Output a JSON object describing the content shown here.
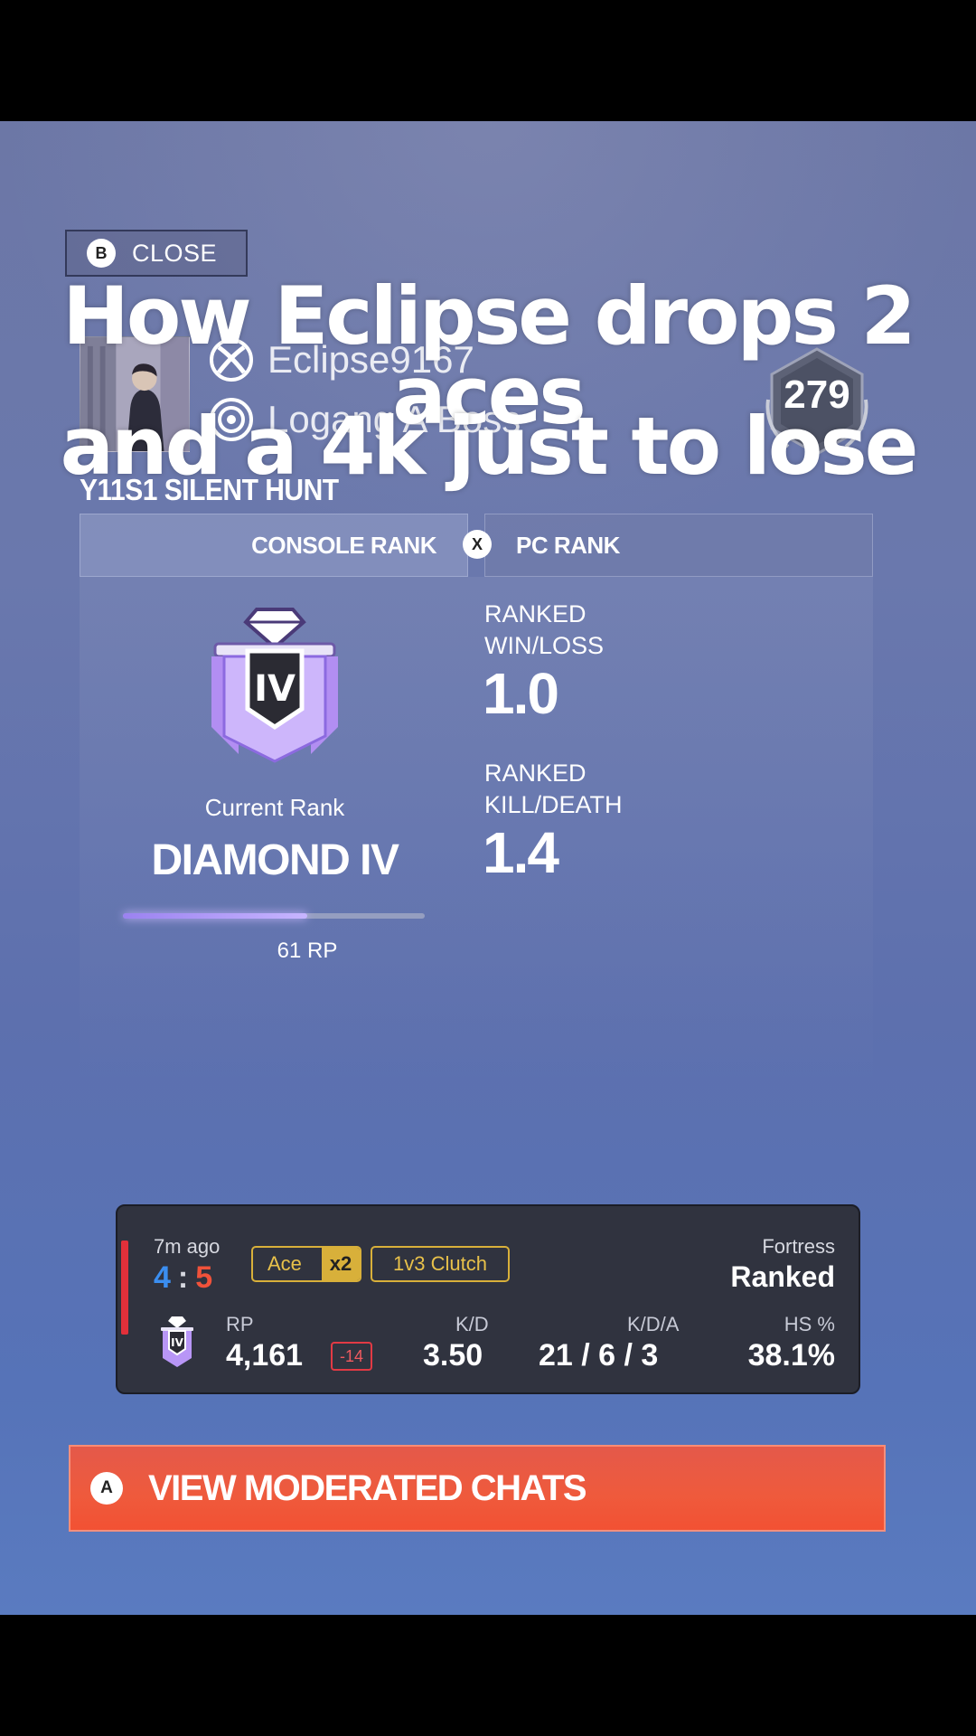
{
  "close_button": {
    "key": "B",
    "label": "CLOSE"
  },
  "profile": {
    "platforms": [
      {
        "icon": "xbox-icon",
        "name": "Eclipse9167"
      },
      {
        "icon": "ubisoft-icon",
        "name": "Logang A Boss"
      }
    ],
    "level": "279",
    "season": "Y11S1 SILENT HUNT"
  },
  "tabs": {
    "console": "CONSOLE RANK",
    "switch_key": "X",
    "pc": "PC RANK"
  },
  "rank": {
    "emblem_numeral": "IV",
    "current_label": "Current Rank",
    "name": "DIAMOND IV",
    "progress_fraction": 0.61,
    "rp_text": "61 RP",
    "stats": [
      {
        "label_line1": "RANKED",
        "label_line2": "WIN/LOSS",
        "value": "1.0"
      },
      {
        "label_line1": "RANKED",
        "label_line2": "KILL/DEATH",
        "value": "1.4"
      }
    ]
  },
  "match": {
    "time_ago": "7m ago",
    "score_blue": "4",
    "score_sep": ":",
    "score_red": "5",
    "badges": {
      "ace": "Ace",
      "ace_mult": "x2",
      "clutch": "1v3 Clutch"
    },
    "map": "Fortress",
    "mode": "Ranked",
    "emblem_numeral": "IV",
    "rp_label": "RP",
    "rp_value": "4,161",
    "rp_delta": "-14",
    "kd_label": "K/D",
    "kd_value": "3.50",
    "kda_label": "K/D/A",
    "kda_value": "21 / 6 / 3",
    "hs_label": "HS %",
    "hs_value": "38.1%",
    "result_color": "#e2303a"
  },
  "moderated_chats": {
    "key": "A",
    "label": "VIEW MODERATED CHATS"
  },
  "caption": {
    "line1": "How Eclipse drops 2 aces",
    "line2": "and a 4k just to lose"
  },
  "colors": {
    "accent_orange": "#ef5a3c",
    "rank_purple": "#a98af0",
    "badge_gold": "#d8b03a",
    "team_blue": "#3b8ef0",
    "team_red": "#f0523a"
  }
}
